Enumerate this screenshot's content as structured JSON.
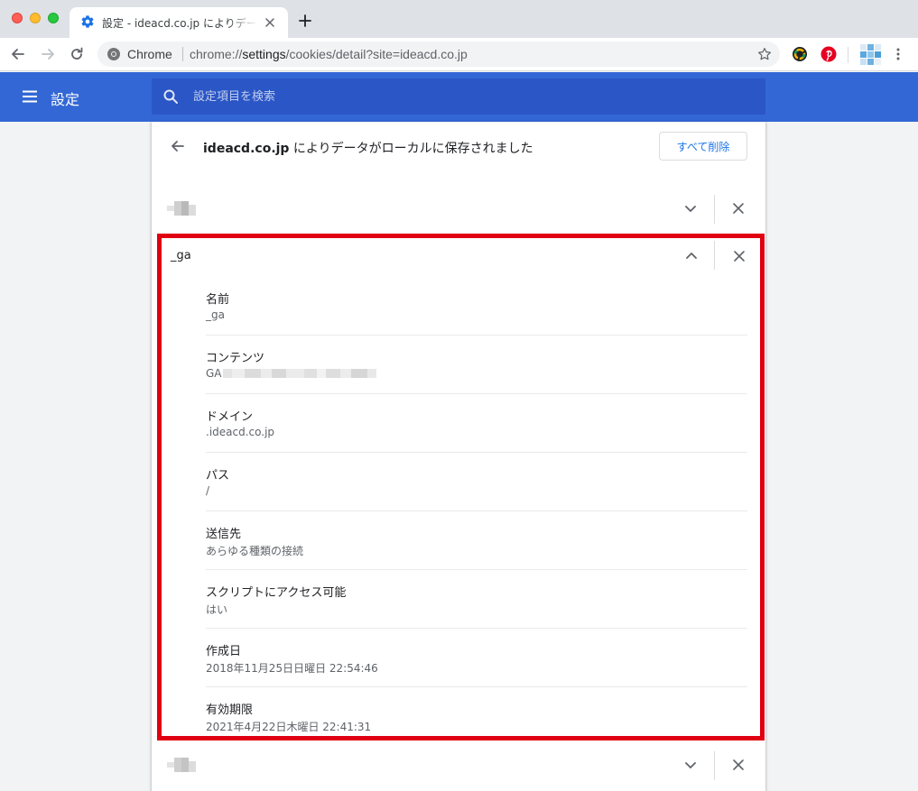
{
  "tab": {
    "title": "設定 - ideacd.co.jp によりデータがローカルに保存されました"
  },
  "toolbar": {
    "site_chip": "Chrome",
    "url_scheme": "chrome://",
    "url_host": "settings",
    "url_path": "/cookies/detail?site=ideacd.co.jp"
  },
  "header": {
    "title": "設定",
    "search_placeholder": "設定項目を検索"
  },
  "page": {
    "site": "ideacd.co.jp",
    "title_suffix": " によりデータがローカルに保存されました",
    "remove_all_label": "すべて削除"
  },
  "cookie_expanded": {
    "name": "_ga",
    "details": [
      {
        "label": "名前",
        "value": "_ga"
      },
      {
        "label": "コンテンツ",
        "value": "GA"
      },
      {
        "label": "ドメイン",
        "value": ".ideacd.co.jp"
      },
      {
        "label": "パス",
        "value": "/"
      },
      {
        "label": "送信先",
        "value": "あらゆる種類の接続"
      },
      {
        "label": "スクリプトにアクセス可能",
        "value": "はい"
      },
      {
        "label": "作成日",
        "value": "2018年11月25日日曜日 22:54:46"
      },
      {
        "label": "有効期限",
        "value": "2021年4月22日木曜日 22:41:31"
      }
    ]
  },
  "colors": {
    "header_blue": "#3367d6",
    "search_blue": "#2a56c6",
    "accent_blue": "#1a73e8",
    "highlight_red": "#e00012"
  },
  "icons": [
    "settings-gear-icon",
    "close-icon",
    "plus-icon",
    "back-arrow-icon",
    "forward-arrow-icon",
    "reload-icon",
    "chrome-icon",
    "star-icon",
    "menu-icon",
    "search-icon",
    "chevron-down-icon",
    "chevron-up-icon",
    "kebab-menu-icon"
  ]
}
